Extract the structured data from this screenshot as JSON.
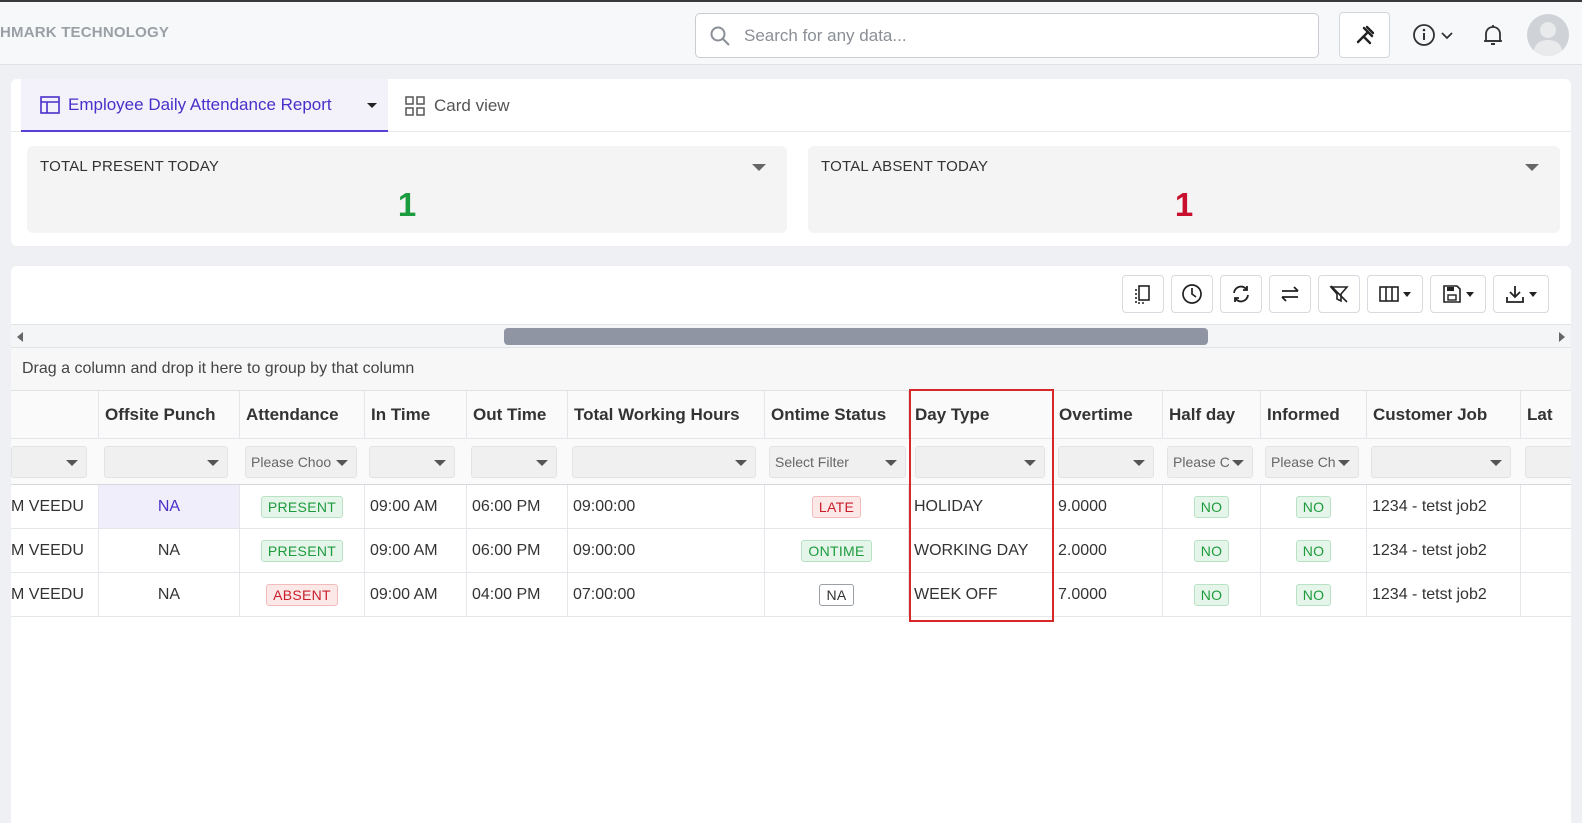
{
  "topbar": {
    "brand": "HMARK TECHNOLOGY",
    "search_placeholder": "Search for any data..."
  },
  "tabs": {
    "active": "Employee Daily Attendance Report",
    "card_view": "Card view"
  },
  "kpis": [
    {
      "title": "TOTAL PRESENT TODAY",
      "value": "1",
      "color": "#1a9b3e"
    },
    {
      "title": "TOTAL ABSENT TODAY",
      "value": "1",
      "color": "#c8102e"
    }
  ],
  "groupbar": "Drag a column and drop it here to group by that column",
  "columns": [
    "",
    "Offsite Punch",
    "Attendance",
    "In Time",
    "Out Time",
    "Total Working Hours",
    "Ontime Status",
    "Day Type",
    "Overtime",
    "Half day",
    "Informed",
    "Customer Job",
    "Lat"
  ],
  "filters": [
    "",
    "",
    "Please Choo",
    "",
    "",
    "",
    "Select Filter",
    "",
    "",
    "Please C",
    "Please Ch",
    "",
    ""
  ],
  "rows": [
    {
      "name": "M VEEDU",
      "offsite": "NA",
      "attendance": "PRESENT",
      "in": "09:00 AM",
      "out": "06:00 PM",
      "hours": "09:00:00",
      "ontime": "LATE",
      "daytype": "HOLIDAY",
      "overtime": "9.0000",
      "halfday": "NO",
      "informed": "NO",
      "job": "1234 - tetst job2"
    },
    {
      "name": "M VEEDU",
      "offsite": "NA",
      "attendance": "PRESENT",
      "in": "09:00 AM",
      "out": "06:00 PM",
      "hours": "09:00:00",
      "ontime": "ONTIME",
      "daytype": "WORKING DAY",
      "overtime": "2.0000",
      "halfday": "NO",
      "informed": "NO",
      "job": "1234 - tetst job2"
    },
    {
      "name": "M VEEDU",
      "offsite": "NA",
      "attendance": "ABSENT",
      "in": "09:00 AM",
      "out": "04:00 PM",
      "hours": "07:00:00",
      "ontime": "NA",
      "daytype": "WEEK OFF",
      "overtime": "7.0000",
      "halfday": "NO",
      "informed": "NO",
      "job": "1234 - tetst job2"
    }
  ],
  "colors": {
    "accent": "#5a3fd6",
    "present": "#1a9b3e",
    "absent": "#c8102e",
    "highlight": "#d62828"
  },
  "icons": [
    "search-icon",
    "tools-icon",
    "info-icon",
    "chevron-down-icon",
    "bell-icon",
    "avatar",
    "table-icon",
    "grid-icon",
    "column-chooser-icon",
    "history-icon",
    "refresh-icon",
    "swap-icon",
    "clear-filter-icon",
    "columns-icon",
    "save-icon",
    "download-icon"
  ]
}
